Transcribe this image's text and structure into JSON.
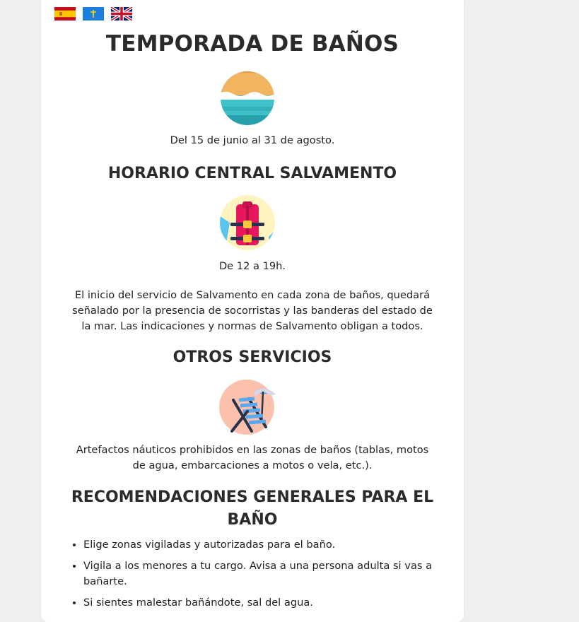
{
  "language_flags": [
    {
      "name": "spanish-flag",
      "label": "Español"
    },
    {
      "name": "asturian-flag",
      "label": "Asturianu"
    },
    {
      "name": "english-flag",
      "label": "English"
    }
  ],
  "season": {
    "title": "TEMPORADA DE BAÑOS",
    "dates": "Del 15 de junio al 31 de agosto."
  },
  "rescue": {
    "title": "HORARIO CENTRAL SALVAMENTO",
    "hours": "De 12 a 19h.",
    "description": "El inicio del servicio de Salvamento en cada zona de baños, quedará señalado por la presencia de socorristas y las banderas del estado de la mar. Las indicaciones y normas de Salvamento obligan a todos."
  },
  "other": {
    "title": "OTROS SERVICIOS",
    "description": "Artefactos náuticos prohibidos en las zonas de baños (tablas, motos de agua, embarcaciones a motos o vela, etc.)."
  },
  "recommendations": {
    "title_line1": "RECOMENDACIONES GENERALES PARA EL",
    "title_line2": "BAÑO",
    "items": [
      "Elige zonas vigiladas y autorizadas para el baño.",
      "Vigila a los menores a tu cargo. Avisa a una persona adulta si vas a bañarte.",
      "Si sientes malestar bañándote, sal del agua."
    ]
  },
  "colors": {
    "page_bg": "#efefef",
    "card_bg": "#ffffff",
    "text": "#2b2b2b"
  }
}
